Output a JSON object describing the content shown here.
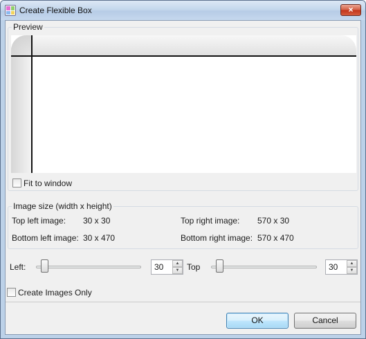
{
  "window": {
    "title": "Create Flexible Box",
    "close_glyph": "×",
    "icon": "flexible-box-app-icon"
  },
  "preview": {
    "group_label": "Preview",
    "fit_to_window_label": "Fit to window",
    "fit_to_window_checked": false
  },
  "image_size": {
    "group_label": "Image size (width x height)",
    "top_left_label": "Top left image:",
    "top_left_value": "30 x 30",
    "top_right_label": "Top right image:",
    "top_right_value": "570 x 30",
    "bottom_left_label": "Bottom left image:",
    "bottom_left_value": "30 x 470",
    "bottom_right_label": "Bottom right image:",
    "bottom_right_value": "570 x 470"
  },
  "controls": {
    "left_label": "Left:",
    "left_value": "30",
    "top_label": "Top",
    "top_value": "30",
    "spin_up_glyph": "▲",
    "spin_down_glyph": "▼",
    "create_images_only_label": "Create Images Only",
    "create_images_only_checked": false
  },
  "buttons": {
    "ok_label": "OK",
    "cancel_label": "Cancel"
  }
}
